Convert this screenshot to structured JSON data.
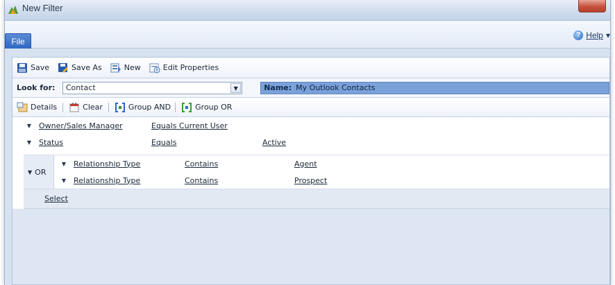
{
  "window": {
    "title": "New Filter"
  },
  "ribbon": {
    "file_tab": "File",
    "help_label": "Help",
    "help_caret": "▾"
  },
  "toolbar": {
    "save": "Save",
    "save_as": "Save As",
    "new": "New",
    "edit_properties": "Edit Properties"
  },
  "lookfor": {
    "label": "Look for:",
    "value": "Contact",
    "name_label": "Name:",
    "name_value": "My Outlook Contacts"
  },
  "commands": {
    "details": "Details",
    "clear": "Clear",
    "group_and": "Group AND",
    "group_or": "Group OR"
  },
  "criteria": {
    "rows": [
      {
        "field": "Owner/Sales Manager",
        "operator": "Equals Current User",
        "value": ""
      },
      {
        "field": "Status",
        "operator": "Equals",
        "value": "Active"
      }
    ],
    "group": {
      "label": "OR",
      "rows": [
        {
          "field": "Relationship Type",
          "operator": "Contains",
          "value": "Agent"
        },
        {
          "field": "Relationship Type",
          "operator": "Contains",
          "value": "Prospect"
        }
      ]
    },
    "select_label": "Select"
  },
  "colors": {
    "file_tab": "#2f68c4",
    "name_box": "#7aa1d8",
    "close_button": "#c5523d",
    "panel": "#dde6f2"
  }
}
